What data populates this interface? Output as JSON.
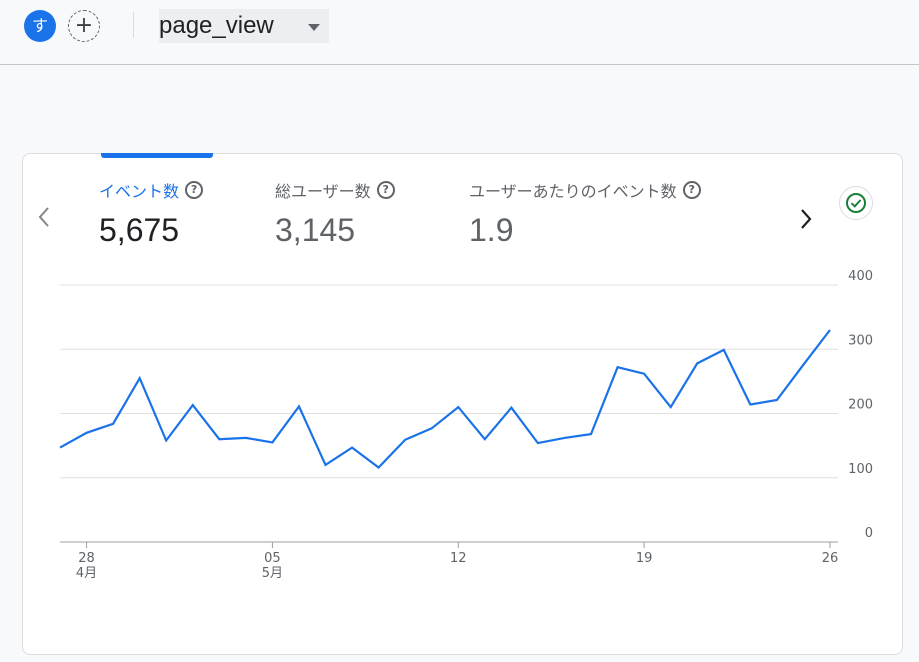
{
  "header": {
    "avatar_letter": "す",
    "add_symbol": "+",
    "event_name": "page_view"
  },
  "metrics": [
    {
      "label": "イベント数",
      "value": "5,675",
      "active": true
    },
    {
      "label": "総ユーザー数",
      "value": "3,145",
      "active": false
    },
    {
      "label": "ユーザーあたりのイベント数",
      "value": "1.9",
      "active": false
    }
  ],
  "help_symbol": "?",
  "colors": {
    "accent": "#1a73e8",
    "check": "#188038"
  },
  "icons": {
    "prev": "chevron-left-icon",
    "next": "chevron-right-icon",
    "status": "check-circle-icon"
  },
  "chart_data": {
    "type": "line",
    "series": [
      {
        "values": [
          147,
          170,
          184,
          255,
          158,
          213,
          160,
          162,
          155,
          211,
          120,
          147,
          116,
          159,
          177,
          210,
          160,
          209,
          154,
          162,
          168,
          272,
          262,
          210,
          278,
          299,
          214,
          221,
          276,
          330
        ]
      }
    ],
    "y_ticks": [
      "0",
      "100",
      "200",
      "300",
      "400"
    ],
    "ylim": [
      0,
      400
    ],
    "x_ticks": [
      {
        "day": "28",
        "month": "4月",
        "index": 1
      },
      {
        "day": "05",
        "month": "5月",
        "index": 8
      },
      {
        "day": "12",
        "month": "",
        "index": 15
      },
      {
        "day": "19",
        "month": "",
        "index": 22
      },
      {
        "day": "26",
        "month": "",
        "index": 29
      }
    ],
    "grid": true
  }
}
